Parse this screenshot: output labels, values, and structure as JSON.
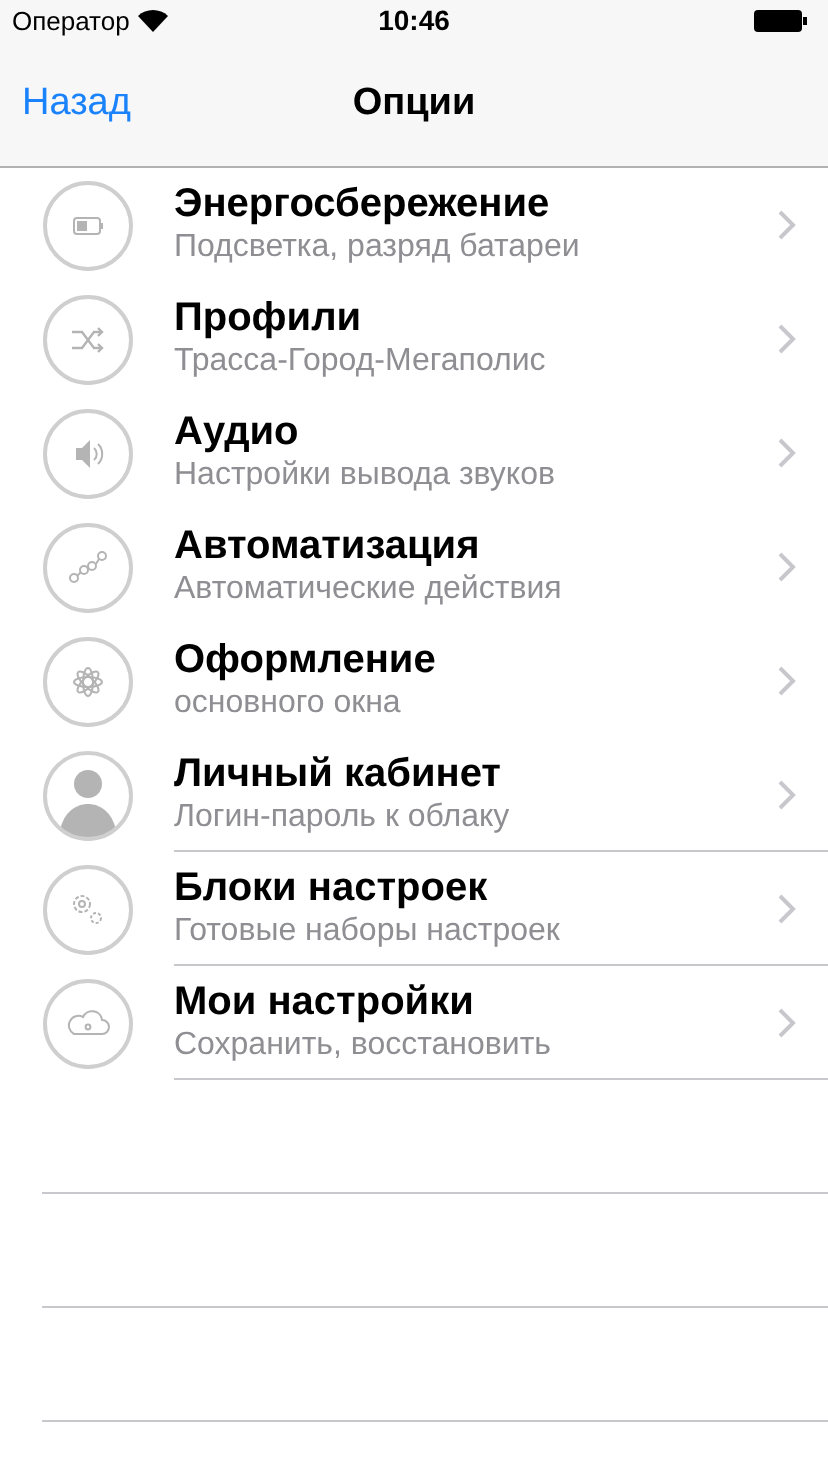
{
  "status_bar": {
    "carrier": "Оператор",
    "time": "10:46"
  },
  "nav": {
    "back": "Назад",
    "title": "Опции"
  },
  "items": [
    {
      "kind": "battery",
      "title": "Энергосбережение",
      "subtitle": "Подсветка, разряд батареи",
      "divider": false
    },
    {
      "kind": "shuffle",
      "title": "Профили",
      "subtitle": "Трасса-Город-Мегаполис",
      "divider": false
    },
    {
      "kind": "speaker",
      "title": "Аудио",
      "subtitle": "Настройки вывода звуков",
      "divider": false
    },
    {
      "kind": "nodes",
      "title": "Автоматизация",
      "subtitle": "Автоматические действия",
      "divider": false
    },
    {
      "kind": "flower",
      "title": "Оформление",
      "subtitle": "основного окна",
      "divider": false
    },
    {
      "kind": "person",
      "title": "Личный кабинет",
      "subtitle": "Логин-пароль к облаку",
      "divider": true
    },
    {
      "kind": "gears",
      "title": "Блоки настроек",
      "subtitle": "Готовые наборы настроек",
      "divider": true
    },
    {
      "kind": "cloud",
      "title": "Мои настройки",
      "subtitle": "Сохранить, восстановить",
      "divider": true
    }
  ]
}
